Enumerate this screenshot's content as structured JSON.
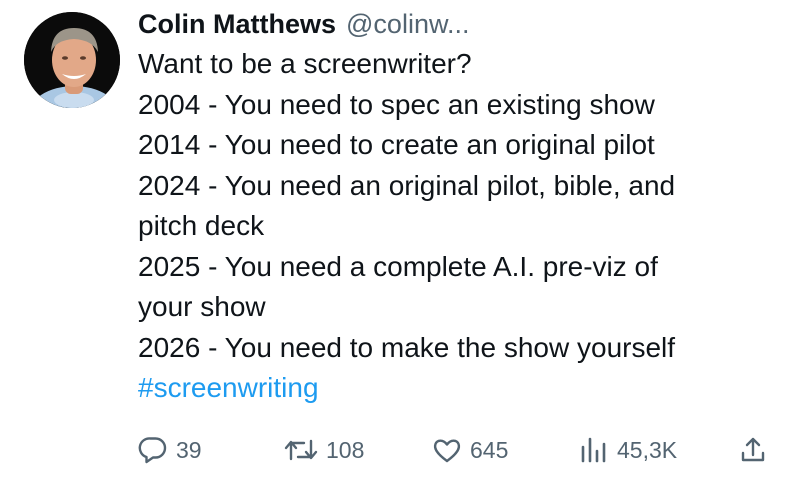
{
  "tweet": {
    "author": {
      "name": "Colin Matthews",
      "handle": "@colinw..."
    },
    "lines": [
      "Want to be a screenwriter?",
      "2004 - You need to spec an existing show",
      "2014 - You need to create an original pilot",
      "2024 - You need an original pilot, bible, and",
      "pitch deck",
      "2025 -  You need a complete A.I. pre-viz of",
      "your show",
      "2026 - You need to make the show yourself"
    ],
    "hashtag": "#screenwriting",
    "stats": {
      "replies": "39",
      "retweets": "108",
      "likes": "645",
      "views": "45,3K"
    }
  },
  "icons": {
    "reply": "reply-bubble-icon",
    "retweet": "retweet-icon",
    "like": "heart-icon",
    "views": "bar-chart-icon",
    "share": "share-upload-icon"
  },
  "colors": {
    "text": "#0f1419",
    "muted": "#536471",
    "link": "#1d9bf0",
    "background": "#ffffff"
  }
}
